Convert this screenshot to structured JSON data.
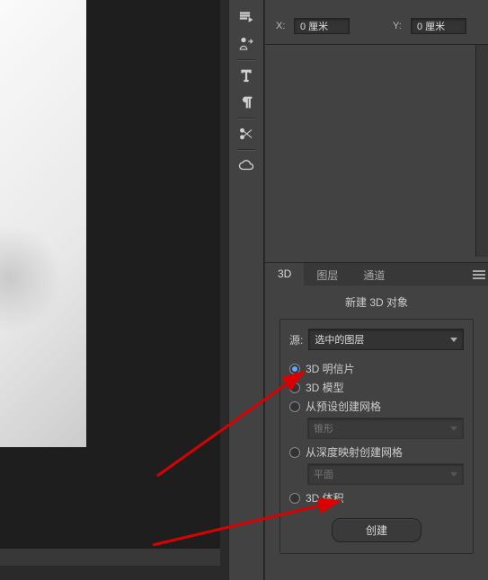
{
  "canvas": {},
  "toolbar": {
    "tool1": "paragraph-flow-icon",
    "tool2": "person-arrow-icon",
    "tool3": "type-icon",
    "tool4": "pilcrow-icon",
    "tool5": "scissors-icon",
    "tool6": "cloud-icon"
  },
  "props": {
    "x_label": "X:",
    "x_value": "0 厘米",
    "y_label": "Y:",
    "y_value": "0 厘米"
  },
  "tabs": {
    "t3d": "3D",
    "layers": "图层",
    "channels": "通道"
  },
  "panel3d": {
    "title": "新建 3D 对象",
    "source_label": "源:",
    "source_value": "选中的图层",
    "opt_postcard": "3D 明信片",
    "opt_model": "3D 模型",
    "opt_mesh": "从预设创建网格",
    "mesh_preset": "锥形",
    "opt_depth": "从深度映射创建网格",
    "depth_preset": "平面",
    "opt_volume": "3D 体积",
    "create_btn": "创建"
  }
}
